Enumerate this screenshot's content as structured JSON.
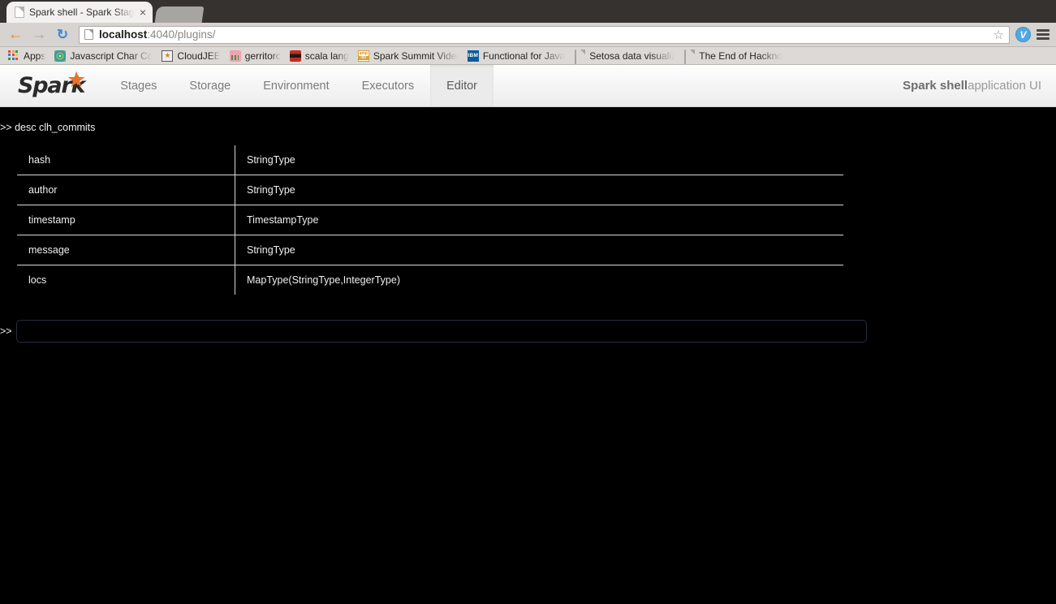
{
  "browser": {
    "tabs": [
      {
        "title": "Spark shell - Spark Stages",
        "close_label": "×"
      }
    ],
    "toolbar": {
      "back_glyph": "←",
      "forward_glyph": "→",
      "reload_glyph": "↻",
      "star_glyph": "☆",
      "extension_label": "V",
      "url_host": "localhost",
      "url_rest": ":4040/plugins/"
    },
    "bookmarks": [
      {
        "label": "Apps",
        "icon": "apps-grid-icon"
      },
      {
        "label": "Javascript Char Co",
        "icon": "spiral-icon"
      },
      {
        "label": "CloudJEE",
        "icon": "cloudjee-icon"
      },
      {
        "label": "gerritorc",
        "icon": "gerrit-icon"
      },
      {
        "label": "scala lang",
        "icon": "scala-icon"
      },
      {
        "label": "Spark Summit Video",
        "icon": "amplab-icon"
      },
      {
        "label": "Functional for Java",
        "icon": "ibm-icon"
      },
      {
        "label": "Setosa data visualiz",
        "icon": "page-icon"
      },
      {
        "label": "The End of Hackno",
        "icon": "page-icon"
      }
    ]
  },
  "spark": {
    "logo_text": "Spark",
    "logo_star": "★",
    "nav": [
      {
        "label": "Stages",
        "active": false
      },
      {
        "label": "Storage",
        "active": false
      },
      {
        "label": "Environment",
        "active": false
      },
      {
        "label": "Executors",
        "active": false
      },
      {
        "label": "Editor",
        "active": true
      }
    ],
    "app_title_bold": "Spark shell",
    "app_title_rest": " application UI"
  },
  "editor": {
    "executed_command": ">> desc clh_commits",
    "table": {
      "rows": [
        {
          "name": "hash",
          "type": "StringType"
        },
        {
          "name": "author",
          "type": "StringType"
        },
        {
          "name": "timestamp",
          "type": "TimestampType"
        },
        {
          "name": "message",
          "type": "StringType"
        },
        {
          "name": "locs",
          "type": "MapType(StringType,IntegerType)"
        }
      ]
    },
    "prompt_sign": ">>",
    "input_value": "",
    "input_placeholder": ""
  },
  "colors": {
    "spark_orange": "#e8722a",
    "terminal_bg": "#000000",
    "terminal_fg": "#f0f0f0",
    "table_border": "#d8d8d8",
    "input_border": "#20303f"
  }
}
